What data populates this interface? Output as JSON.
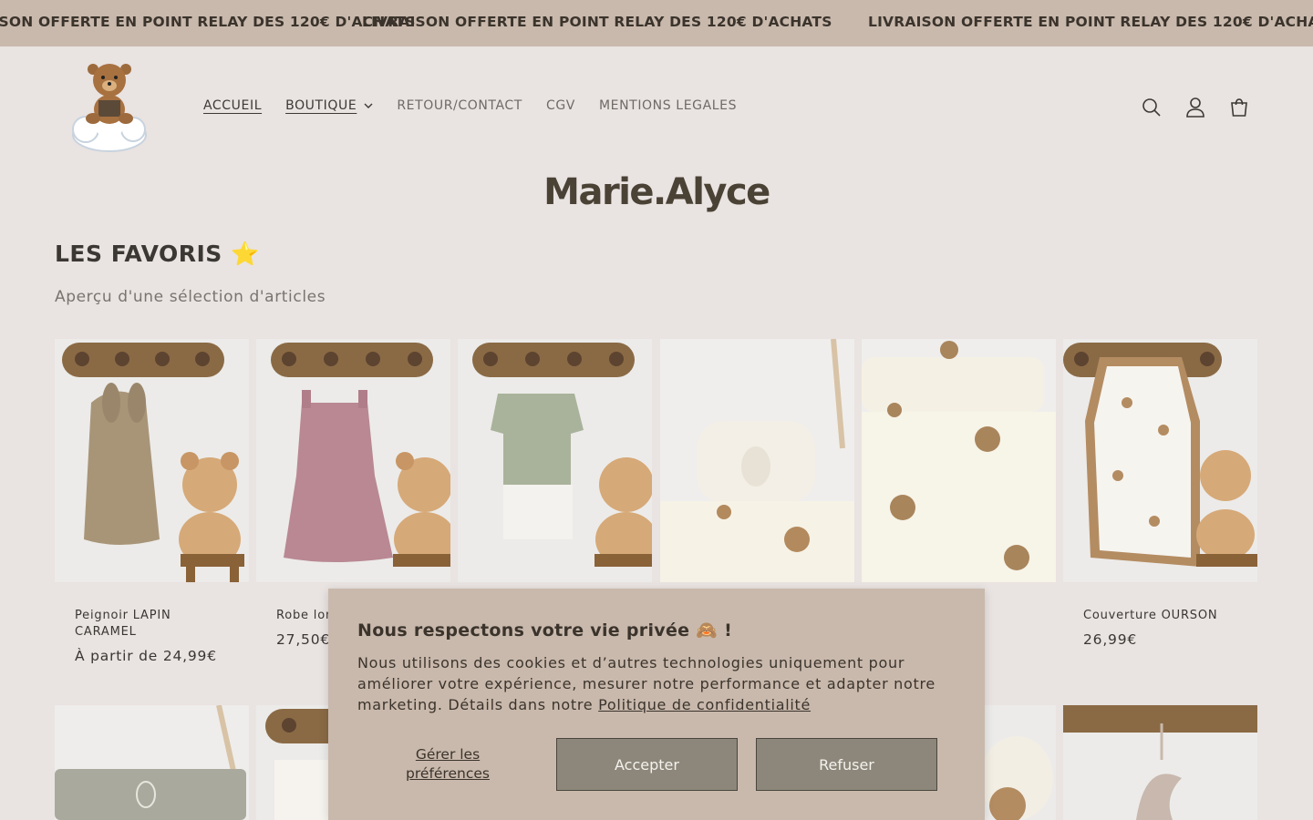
{
  "announcement": {
    "text": "LIVRAISON OFFERTE EN POINT RELAY DES 120€ D'ACHATS"
  },
  "nav": {
    "items": [
      {
        "label": "ACCUEIL"
      },
      {
        "label": "BOUTIQUE"
      },
      {
        "label": "RETOUR/CONTACT"
      },
      {
        "label": "CGV"
      },
      {
        "label": "MENTIONS LEGALES"
      }
    ]
  },
  "header_icons": [
    "search-icon",
    "account-icon",
    "cart-icon"
  ],
  "brand": "Marie.Alyce",
  "section": {
    "title": "LES FAVORIS ⭐",
    "subtitle": "Aperçu d'une sélection d'articles"
  },
  "products": [
    {
      "name": "Peignoir LAPIN CARAMEL",
      "price": "À partir de 24,99€"
    },
    {
      "name": "Robe lon",
      "price": "27,50€"
    },
    {
      "name": "",
      "price": ""
    },
    {
      "name": "",
      "price": ""
    },
    {
      "name": "",
      "price": ""
    },
    {
      "name": "Couverture OURSON",
      "price": "26,99€"
    }
  ],
  "cookie": {
    "title": "Nous respectons votre vie privée 🙈 !",
    "text": "Nous utilisons des cookies et d’autres technologies uniquement pour améliorer votre expérience, mesurer notre performance et adapter notre marketing. Détails dans notre",
    "link": "Politique de confidentialité",
    "manage": "Gérer les préférences",
    "accept": "Accepter",
    "refuse": "Refuser"
  },
  "colors": {
    "announcement_bg": "#c9b9ac",
    "page_bg": "#e9e3e1",
    "button_bg": "#8c877a"
  }
}
